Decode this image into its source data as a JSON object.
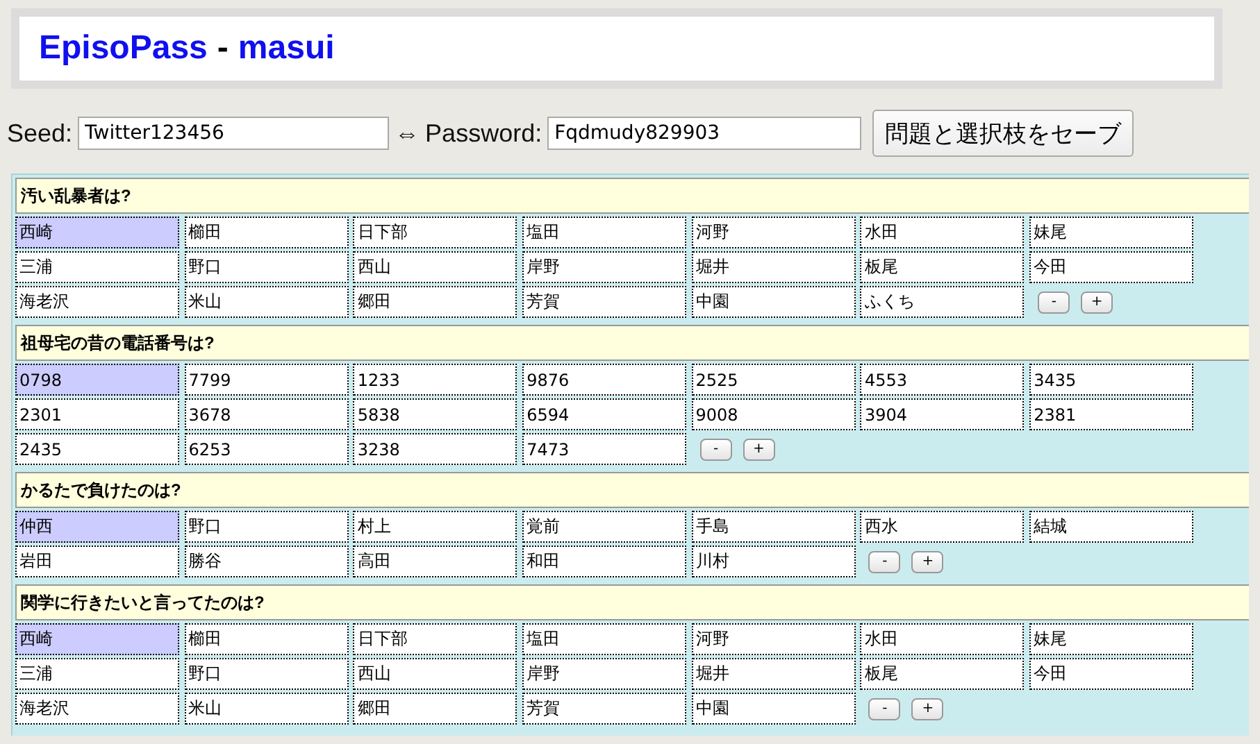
{
  "header": {
    "app_name": "EpisoPass",
    "separator": "-",
    "user": "masui"
  },
  "seed": {
    "label": "Seed:",
    "value": "Twitter123456"
  },
  "arrow": "⇔",
  "password": {
    "label": "Password:",
    "value": "Fqdmudy829903"
  },
  "save_button": "問題と選択枝をセーブ",
  "questions": [
    {
      "question": "汚い乱暴者は?",
      "choices": [
        {
          "label": "西崎",
          "selected": true
        },
        {
          "label": "櫛田",
          "selected": false
        },
        {
          "label": "日下部",
          "selected": false
        },
        {
          "label": "塩田",
          "selected": false
        },
        {
          "label": "河野",
          "selected": false
        },
        {
          "label": "水田",
          "selected": false
        },
        {
          "label": "妹尾",
          "selected": false
        },
        {
          "label": "三浦",
          "selected": false
        },
        {
          "label": "野口",
          "selected": false
        },
        {
          "label": "西山",
          "selected": false
        },
        {
          "label": "岸野",
          "selected": false
        },
        {
          "label": "堀井",
          "selected": false
        },
        {
          "label": "板尾",
          "selected": false
        },
        {
          "label": "今田",
          "selected": false
        },
        {
          "label": "海老沢",
          "selected": false
        },
        {
          "label": "米山",
          "selected": false
        },
        {
          "label": "郷田",
          "selected": false
        },
        {
          "label": "芳賀",
          "selected": false
        },
        {
          "label": "中園",
          "selected": false
        },
        {
          "label": "ふくち",
          "selected": false
        }
      ],
      "buttons": [
        "-",
        "+"
      ]
    },
    {
      "question": "祖母宅の昔の電話番号は?",
      "choices": [
        {
          "label": "0798",
          "selected": true
        },
        {
          "label": "7799",
          "selected": false
        },
        {
          "label": "1233",
          "selected": false
        },
        {
          "label": "9876",
          "selected": false
        },
        {
          "label": "2525",
          "selected": false
        },
        {
          "label": "4553",
          "selected": false
        },
        {
          "label": "3435",
          "selected": false
        },
        {
          "label": "2301",
          "selected": false
        },
        {
          "label": "3678",
          "selected": false
        },
        {
          "label": "5838",
          "selected": false
        },
        {
          "label": "6594",
          "selected": false
        },
        {
          "label": "9008",
          "selected": false
        },
        {
          "label": "3904",
          "selected": false
        },
        {
          "label": "2381",
          "selected": false
        },
        {
          "label": "2435",
          "selected": false
        },
        {
          "label": "6253",
          "selected": false
        },
        {
          "label": "3238",
          "selected": false
        },
        {
          "label": "7473",
          "selected": false
        }
      ],
      "buttons": [
        "-",
        "+"
      ]
    },
    {
      "question": "かるたで負けたのは?",
      "choices": [
        {
          "label": "仲西",
          "selected": true
        },
        {
          "label": "野口",
          "selected": false
        },
        {
          "label": "村上",
          "selected": false
        },
        {
          "label": "覚前",
          "selected": false
        },
        {
          "label": "手島",
          "selected": false
        },
        {
          "label": "西水",
          "selected": false
        },
        {
          "label": "結城",
          "selected": false
        },
        {
          "label": "岩田",
          "selected": false
        },
        {
          "label": "勝谷",
          "selected": false
        },
        {
          "label": "高田",
          "selected": false
        },
        {
          "label": "和田",
          "selected": false
        },
        {
          "label": "川村",
          "selected": false
        }
      ],
      "buttons": [
        "-",
        "+"
      ]
    },
    {
      "question": "関学に行きたいと言ってたのは?",
      "choices": [
        {
          "label": "西崎",
          "selected": true
        },
        {
          "label": "櫛田",
          "selected": false
        },
        {
          "label": "日下部",
          "selected": false
        },
        {
          "label": "塩田",
          "selected": false
        },
        {
          "label": "河野",
          "selected": false
        },
        {
          "label": "水田",
          "selected": false
        },
        {
          "label": "妹尾",
          "selected": false
        },
        {
          "label": "三浦",
          "selected": false
        },
        {
          "label": "野口",
          "selected": false
        },
        {
          "label": "西山",
          "selected": false
        },
        {
          "label": "岸野",
          "selected": false
        },
        {
          "label": "堀井",
          "selected": false
        },
        {
          "label": "板尾",
          "selected": false
        },
        {
          "label": "今田",
          "selected": false
        },
        {
          "label": "海老沢",
          "selected": false
        },
        {
          "label": "米山",
          "selected": false
        },
        {
          "label": "郷田",
          "selected": false
        },
        {
          "label": "芳賀",
          "selected": false
        },
        {
          "label": "中園",
          "selected": false
        }
      ],
      "buttons": [
        "-",
        "+"
      ]
    }
  ]
}
